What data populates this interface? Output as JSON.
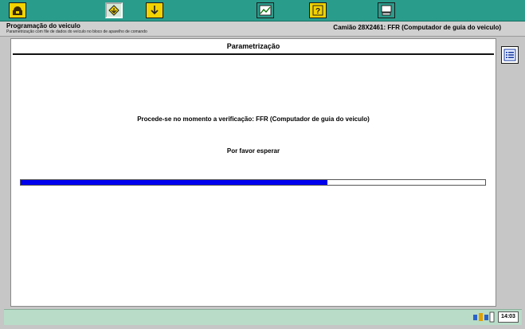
{
  "header": {
    "title": "Programação do veiculo",
    "subtitle": "Parametrização com file de dados do veículo no bloco de aparelho de comando",
    "vehicle": "Camião 28X2461: FFR (Computador de guia do veiculo)"
  },
  "toolbar": {
    "buttons": [
      {
        "icon": "home-icon"
      },
      {
        "icon": "arrow-down-icon",
        "active": true
      },
      {
        "icon": "download-icon"
      },
      {
        "icon": "chart-icon"
      },
      {
        "icon": "help-icon"
      },
      {
        "icon": "computer-icon"
      }
    ]
  },
  "panel": {
    "title": "Parametrização",
    "message": "Procede-se no momento a verificação: FFR (Computador de guia do veiculo)",
    "wait": "Por favor esperar"
  },
  "progress": {
    "percent": 66,
    "color": "#0000ee"
  },
  "sidebar": {
    "list_button_icon": "list-icon"
  },
  "status": {
    "time": "14:03"
  },
  "colors": {
    "toolbar": "#2a9c8c",
    "progress": "#0000ee",
    "statusbar": "#b8dcc8",
    "button_yellow": "#f2d200"
  }
}
